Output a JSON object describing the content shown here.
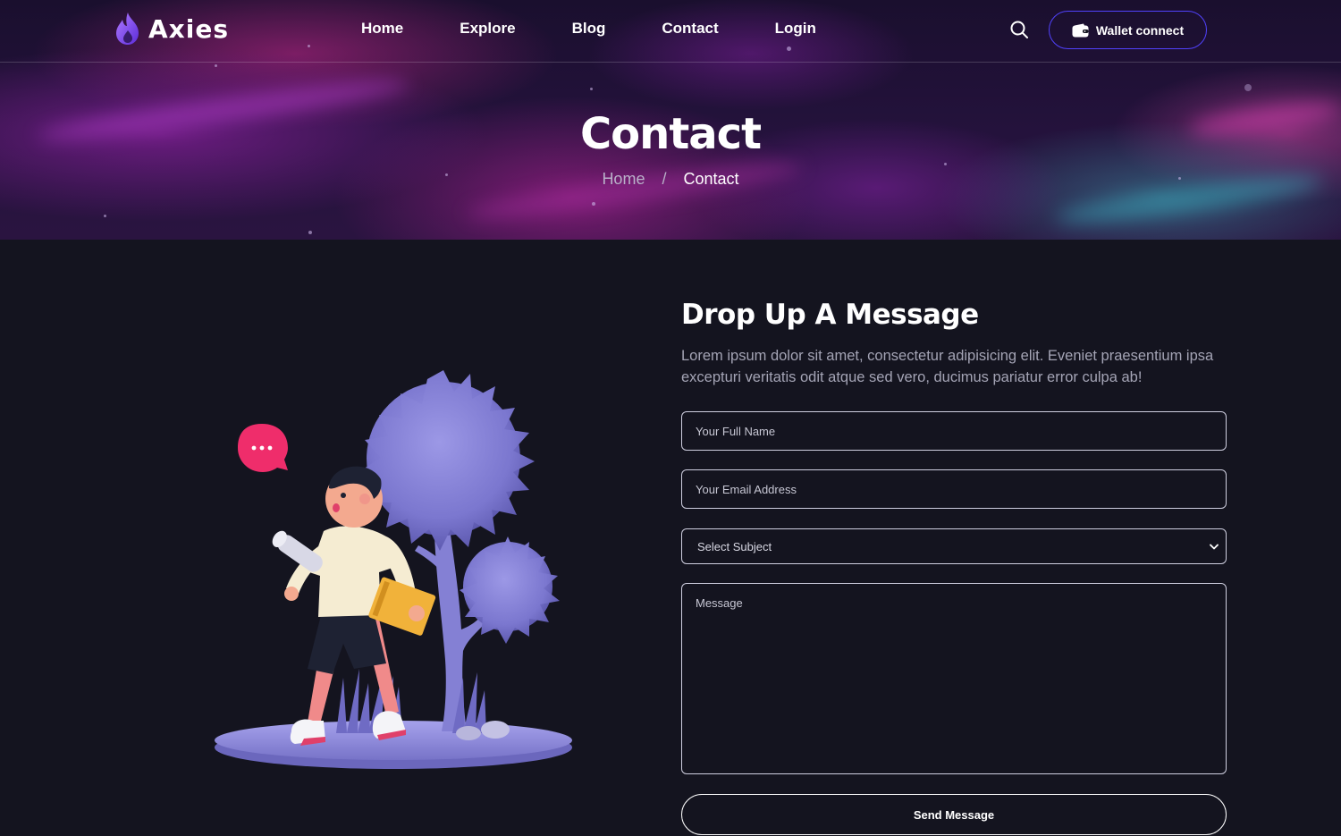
{
  "brand": {
    "name": "Axies"
  },
  "nav": {
    "items": [
      "Home",
      "Explore",
      "Blog",
      "Contact",
      "Login"
    ],
    "wallet_label": "Wallet connect"
  },
  "hero": {
    "title": "Contact",
    "breadcrumb": {
      "home": "Home",
      "separator": "/",
      "current": "Contact"
    }
  },
  "contact": {
    "heading": "Drop Up A Message",
    "description": "Lorem ipsum dolor sit amet, consectetur adipisicing elit. Eveniet praesentium ipsa excepturi veritatis odit atque sed vero, ducimus pariatur error culpa ab!",
    "fields": {
      "name_placeholder": "Your Full Name",
      "email_placeholder": "Your Email Address",
      "subject_selected": "Select Subject",
      "message_placeholder": "Message"
    },
    "submit_label": "Send Message"
  },
  "colors": {
    "background": "#14141f",
    "accent": "#5142fc",
    "chat_bubble": "#ef2d6b",
    "illustration_lavender": "#8a86d8"
  },
  "icons": [
    "flame-logo-icon",
    "search-icon",
    "wallet-icon",
    "chevron-down-icon",
    "chat-bubble-icon"
  ]
}
